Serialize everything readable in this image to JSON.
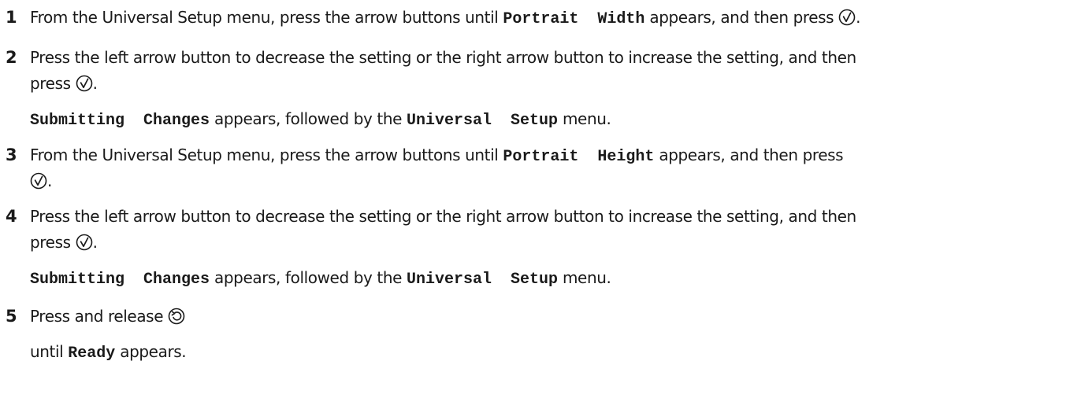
{
  "steps": [
    {
      "number": "1",
      "lines": [
        {
          "parts": [
            {
              "t": "From the Universal Setup menu, press the arrow buttons until "
            },
            {
              "t": "Portrait  Width",
              "mono": true
            },
            {
              "t": " appears, and then press "
            },
            {
              "icon": "select-icon"
            },
            {
              "t": "."
            }
          ]
        }
      ]
    },
    {
      "number": "2",
      "lines": [
        {
          "parts": [
            {
              "t": "Press the left arrow button to decrease the setting or the right arrow button to increase the setting, and then"
            }
          ]
        },
        {
          "parts": [
            {
              "t": "press "
            },
            {
              "icon": "select-icon"
            },
            {
              "t": "."
            }
          ]
        },
        {
          "parts": [
            {
              "t": "Submitting  Changes",
              "mono": true
            },
            {
              "t": " appears, followed by the "
            },
            {
              "t": "Universal  Setup",
              "mono": true
            },
            {
              "t": " menu."
            }
          ]
        }
      ]
    },
    {
      "number": "3",
      "lines": [
        {
          "parts": [
            {
              "t": "From the Universal Setup menu, press the arrow buttons until "
            },
            {
              "t": "Portrait  Height",
              "mono": true
            },
            {
              "t": " appears, and then press"
            }
          ]
        },
        {
          "parts": [
            {
              "icon": "select-icon"
            },
            {
              "t": "."
            }
          ]
        }
      ]
    },
    {
      "number": "4",
      "lines": [
        {
          "parts": [
            {
              "t": "Press the left arrow button to decrease the setting or the right arrow button to increase the setting, and then"
            }
          ]
        },
        {
          "parts": [
            {
              "t": "press "
            },
            {
              "icon": "select-icon"
            },
            {
              "t": "."
            }
          ]
        },
        {
          "parts": [
            {
              "t": "Submitting  Changes",
              "mono": true
            },
            {
              "t": " appears, followed by the "
            },
            {
              "t": "Universal  Setup",
              "mono": true
            },
            {
              "t": " menu."
            }
          ]
        }
      ]
    },
    {
      "number": "5",
      "lines": [
        {
          "parts": [
            {
              "t": "Press and release "
            },
            {
              "icon": "back-icon"
            }
          ]
        },
        {
          "parts": [
            {
              "t": "until "
            },
            {
              "t": "Ready",
              "mono": true
            },
            {
              "t": " appears."
            }
          ]
        }
      ]
    }
  ]
}
